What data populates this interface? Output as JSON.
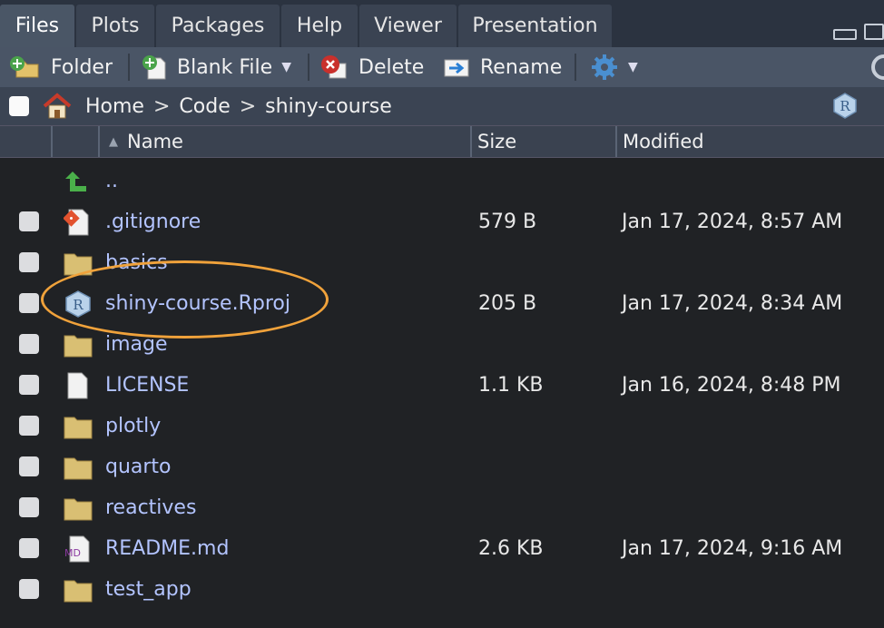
{
  "tabs": [
    {
      "label": "Files",
      "active": true
    },
    {
      "label": "Plots",
      "active": false
    },
    {
      "label": "Packages",
      "active": false
    },
    {
      "label": "Help",
      "active": false
    },
    {
      "label": "Viewer",
      "active": false
    },
    {
      "label": "Presentation",
      "active": false
    }
  ],
  "toolbar": {
    "new_folder_label": "Folder",
    "blank_file_label": "Blank File",
    "delete_label": "Delete",
    "rename_label": "Rename"
  },
  "breadcrumb": {
    "items": [
      "Home",
      "Code",
      "shiny-course"
    ]
  },
  "columns": {
    "name": "Name",
    "size": "Size",
    "modified": "Modified"
  },
  "sort": {
    "column": "Name",
    "direction": "ascending"
  },
  "files": [
    {
      "name": "..",
      "size": "",
      "modified": "",
      "type": "up"
    },
    {
      "name": ".gitignore",
      "size": "579 B",
      "modified": "Jan 17, 2024, 8:57 AM",
      "type": "git"
    },
    {
      "name": "basics",
      "size": "",
      "modified": "",
      "type": "folder"
    },
    {
      "name": "shiny-course.Rproj",
      "size": "205 B",
      "modified": "Jan 17, 2024, 8:34 AM",
      "type": "rproj"
    },
    {
      "name": "image",
      "size": "",
      "modified": "",
      "type": "folder"
    },
    {
      "name": "LICENSE",
      "size": "1.1 KB",
      "modified": "Jan 16, 2024, 8:48 PM",
      "type": "file"
    },
    {
      "name": "plotly",
      "size": "",
      "modified": "",
      "type": "folder"
    },
    {
      "name": "quarto",
      "size": "",
      "modified": "",
      "type": "folder"
    },
    {
      "name": "reactives",
      "size": "",
      "modified": "",
      "type": "folder"
    },
    {
      "name": "README.md",
      "size": "2.6 KB",
      "modified": "Jan 17, 2024, 9:16 AM",
      "type": "md"
    },
    {
      "name": "test_app",
      "size": "",
      "modified": "",
      "type": "folder"
    }
  ],
  "colors": {
    "background": "#202225",
    "filename": "#b3c4ff",
    "highlight_ring": "#f0a23b"
  }
}
